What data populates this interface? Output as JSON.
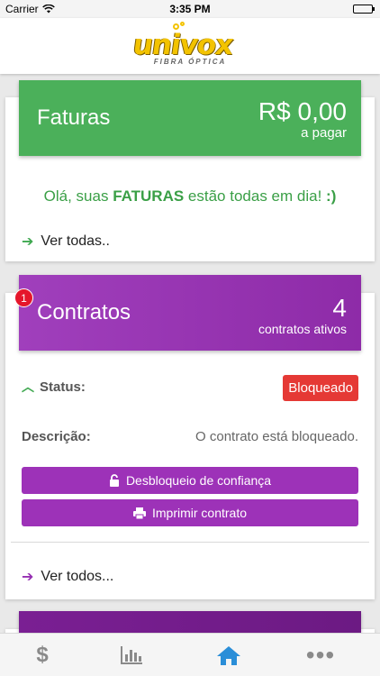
{
  "status_bar": {
    "carrier": "Carrier",
    "time": "3:35 PM"
  },
  "brand": {
    "name": "univox",
    "tagline": "FIBRA ÓPTICA",
    "color": "#f3c300"
  },
  "faturas": {
    "title": "Faturas",
    "amount": "R$ 0,00",
    "amount_sub": "a pagar",
    "greeting_start": "Olá, suas ",
    "greeting_bold": "FATURAS",
    "greeting_mid": " estão todas em dia! ",
    "greeting_end": ":)",
    "link": "Ver todas..",
    "color": "#4bb05a"
  },
  "contratos": {
    "badge": "1",
    "title": "Contratos",
    "count": "4",
    "count_sub": "contratos ativos",
    "status_label": "Status:",
    "status_value": "Bloqueado",
    "desc_label": "Descrição:",
    "desc_value": "O contrato está bloqueado.",
    "btn_unlock": "Desbloqueio de confiança",
    "btn_print": "Imprimir contrato",
    "link": "Ver todos...",
    "color": "#9d32b8"
  },
  "tabbar": {
    "items": [
      {
        "icon": "dollar-icon"
      },
      {
        "icon": "bar-chart-icon"
      },
      {
        "icon": "home-icon",
        "active": true
      },
      {
        "icon": "more-icon"
      }
    ],
    "active_color": "#2a8ed8"
  }
}
